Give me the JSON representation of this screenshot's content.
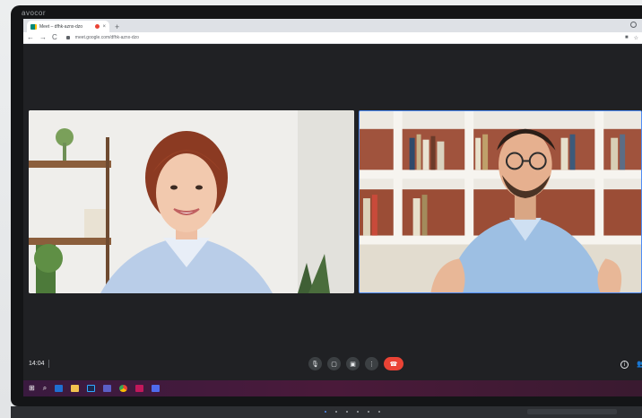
{
  "monitor": {
    "brand": "avocor"
  },
  "browser": {
    "tab_title": "Meet – dfhk-aznx-dzo",
    "tab_close": "×",
    "new_tab": "+",
    "back": "←",
    "forward": "→",
    "reload": "C",
    "url": "meet.google.com/dfhk-aznx-dzo",
    "camera_icon": "■",
    "star_icon": "☆"
  },
  "meet": {
    "clock": "14:04",
    "mic_icon": "🎙",
    "camera_icon": "▢",
    "present_icon": "▣",
    "more_icon": "⋮",
    "end_call_icon": "☎",
    "info_icon": "i",
    "people_icon": "👥"
  },
  "taskbar": {
    "start_icon": "⊞",
    "search_icon": "⌕",
    "apps": [
      {
        "name": "outlook",
        "color": "#1f6fd1"
      },
      {
        "name": "file-explorer",
        "color": "#f2c14e"
      },
      {
        "name": "photoshop",
        "color": "#1b2a4f"
      },
      {
        "name": "teams",
        "color": "#5b5fc7"
      },
      {
        "name": "chrome",
        "color": "#34a853"
      },
      {
        "name": "app-red",
        "color": "#c2185b"
      },
      {
        "name": "teams-alt",
        "color": "#4f6bed"
      }
    ]
  },
  "colors": {
    "meet_bg": "#202124",
    "active_speaker": "#4f8df5",
    "end_call": "#ea4335"
  }
}
